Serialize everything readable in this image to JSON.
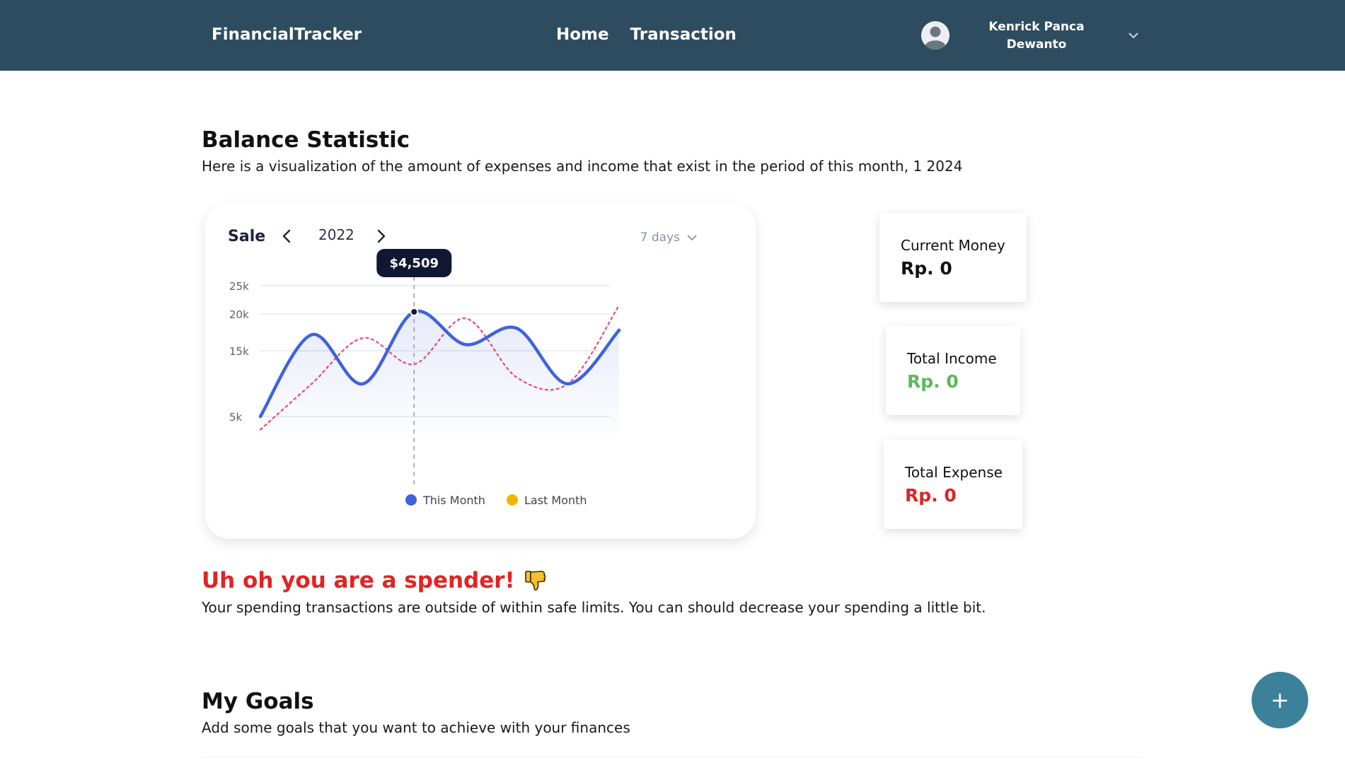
{
  "nav": {
    "brand": "FinancialTracker",
    "links": [
      "Home",
      "Transaction"
    ],
    "user_name_line1": "Kenrick Panca",
    "user_name_line2": "Dewanto",
    "icons": {
      "avatar": "user-avatar-icon",
      "dropdown": "chevron-down-icon"
    }
  },
  "balance": {
    "title": "Balance Statistic",
    "subtitle": "Here is a visualization of the amount of expenses and income that exist in the period of this month, 1 2024"
  },
  "chart_card": {
    "title": "Sale",
    "year": "2022",
    "range": "7 days",
    "tooltip": "$4,509",
    "legend": [
      "This Month",
      "Last Month"
    ],
    "legend_colors": [
      "#3e63dd",
      "#f4b400"
    ]
  },
  "chart_data": {
    "type": "line",
    "title": "Sale",
    "xlabel": "",
    "ylabel": "",
    "y_ticks": [
      "25k",
      "20k",
      "15k",
      "5k"
    ],
    "series": [
      {
        "name": "This Month",
        "color": "#3e63dd",
        "values": [
          5000,
          17500,
          10000,
          21000,
          16000,
          18500,
          10000,
          18200
        ]
      },
      {
        "name": "Last Month",
        "color": "#f04379",
        "values": [
          3000,
          10000,
          17000,
          13000,
          20000,
          11000,
          10000,
          22000
        ]
      }
    ],
    "highlight": {
      "value": "$4,509"
    },
    "grid": true,
    "legend_position": "bottom"
  },
  "stats": {
    "current_money": {
      "label": "Current Money",
      "value": "Rp. 0",
      "color": "#111111"
    },
    "total_income": {
      "label": "Total Income",
      "value": "Rp. 0",
      "color": "#5cb85c"
    },
    "total_expense": {
      "label": "Total Expense",
      "value": "Rp. 0",
      "color": "#e02424"
    }
  },
  "spender": {
    "title": "Uh oh you are a spender!",
    "message": "Your spending transactions are outside of within safe limits. You can should decrease your spending a little bit.",
    "icon": "thumbs-down-icon"
  },
  "goals": {
    "title": "My Goals",
    "subtitle": "Add some goals that you want to achieve with your finances"
  },
  "fab": {
    "label": "+"
  }
}
